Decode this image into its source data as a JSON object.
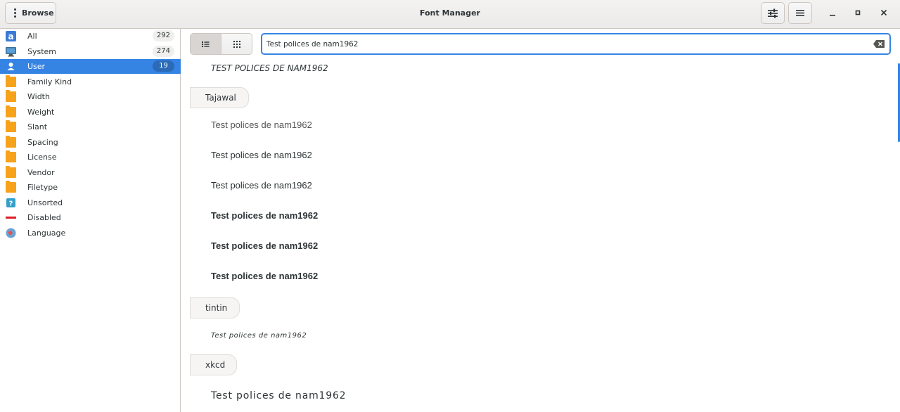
{
  "window": {
    "title": "Font Manager"
  },
  "header": {
    "browse_label": "Browse"
  },
  "icons": {
    "settings": "sliders-icon",
    "menu": "hamburger-menu-icon",
    "minimize": "minimize-icon",
    "maximize": "maximize-icon",
    "close": "close-icon"
  },
  "sidebar": {
    "items": [
      {
        "label": "All",
        "count": "292",
        "icon": "font-a-icon"
      },
      {
        "label": "System",
        "count": "274",
        "icon": "monitor-icon"
      },
      {
        "label": "User",
        "count": "19",
        "icon": "user-icon",
        "selected": true
      },
      {
        "label": "Family Kind",
        "icon": "folder-icon"
      },
      {
        "label": "Width",
        "icon": "folder-icon"
      },
      {
        "label": "Weight",
        "icon": "folder-icon"
      },
      {
        "label": "Slant",
        "icon": "folder-icon"
      },
      {
        "label": "Spacing",
        "icon": "folder-icon"
      },
      {
        "label": "License",
        "icon": "folder-icon"
      },
      {
        "label": "Vendor",
        "icon": "folder-icon"
      },
      {
        "label": "Filetype",
        "icon": "folder-icon"
      },
      {
        "label": "Unsorted",
        "icon": "question-icon"
      },
      {
        "label": "Disabled",
        "icon": "disabled-icon"
      },
      {
        "label": "Language",
        "icon": "language-icon"
      }
    ]
  },
  "search": {
    "value": "Test polices de nam1962",
    "placeholder": ""
  },
  "preview": {
    "first_sample": "TEST POLICES DE NAM1962",
    "families": [
      {
        "name": "Tajawal",
        "samples": [
          "Test polices de nam1962",
          "Test polices de nam1962",
          "Test polices de nam1962",
          "Test polices de nam1962",
          "Test polices de nam1962",
          "Test polices de nam1962"
        ]
      },
      {
        "name": "tintin",
        "samples": [
          "Test polices de nam1962"
        ]
      },
      {
        "name": "xkcd",
        "samples": [
          "Test polices de nam1962"
        ]
      }
    ]
  },
  "colors": {
    "accent": "#3584e4",
    "folder": "#f7a21b",
    "disabled": "#e01b24"
  }
}
